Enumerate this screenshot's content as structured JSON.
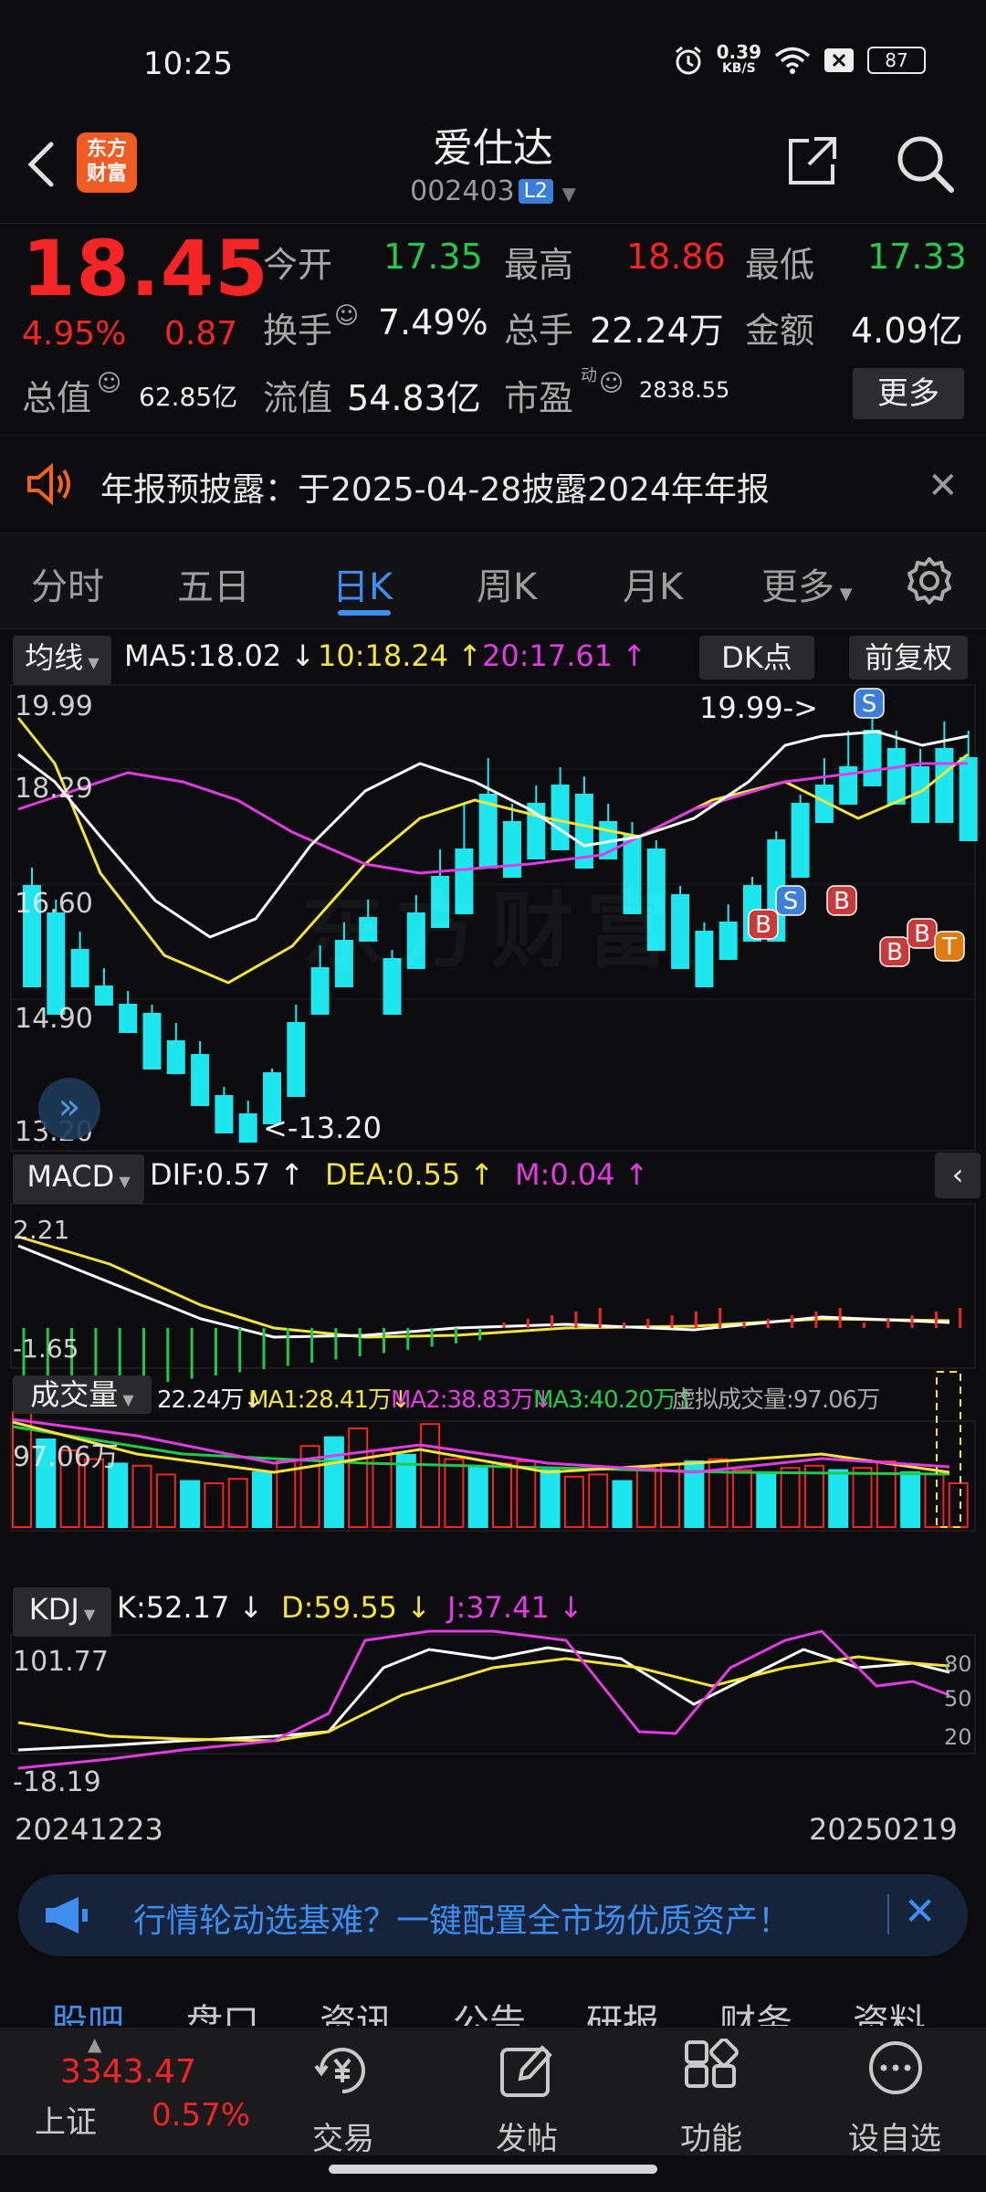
{
  "status_bar": {
    "time": "10:25",
    "net_speed_top": "0.39",
    "net_speed_bottom": "KB/S",
    "battery": "87"
  },
  "header": {
    "logo_line1": "东方",
    "logo_line2": "财富",
    "stock_name": "爱仕达",
    "stock_code": "002403",
    "level_badge": "L2"
  },
  "quote": {
    "price": "18.45",
    "change_pct": "4.95%",
    "change_amt": "0.87",
    "open_label": "今开",
    "open": "17.35",
    "high_label": "最高",
    "high": "18.86",
    "low_label": "最低",
    "low": "17.33",
    "turnover_label": "换手",
    "turnover": "7.49%",
    "volume_label": "总手",
    "volume": "22.24万",
    "amount_label": "金额",
    "amount": "4.09亿",
    "mktcap_label": "总值",
    "mktcap": "62.85亿",
    "float_label": "流值",
    "float": "54.83亿",
    "pe_label": "市盈",
    "pe_sup": "动",
    "pe": "2838.55",
    "more_button": "更多"
  },
  "notice": {
    "text": "年报预披露：于2025-04-28披露2024年年报"
  },
  "period_tabs": [
    {
      "label": "分时"
    },
    {
      "label": "五日"
    },
    {
      "label": "日K",
      "active": true
    },
    {
      "label": "周K"
    },
    {
      "label": "月K"
    },
    {
      "label": "更多"
    }
  ],
  "ma_row": {
    "selector": "均线",
    "ma5": "MA5:18.02 ↓",
    "ma10": "10:18.24 ↑",
    "ma20": "20:17.61 ↑",
    "dk_button": "DK点",
    "adjust_button": "前复权"
  },
  "kline": {
    "y_labels": [
      "19.99",
      "18.29",
      "16.60",
      "14.90",
      "13.20"
    ],
    "max_marker": "19.99->",
    "min_marker": "<-13.20",
    "watermark": "东方财富",
    "signals": [
      "S",
      "S",
      "B",
      "B",
      "B",
      "B",
      "T"
    ]
  },
  "macd": {
    "selector": "MACD",
    "dif": "DIF:0.57 ↑",
    "dea": "DEA:0.55 ↑",
    "m": "M:0.04 ↑",
    "y_top": "2.21",
    "y_bottom": "-1.65"
  },
  "volume_panel": {
    "selector": "成交量",
    "vol": "22.24万↓",
    "ma1": "MA1:28.41万↓",
    "ma2": "MA2:38.83万↓",
    "ma3": "MA3:40.20万↑",
    "virtual": "虚拟成交量:97.06万",
    "y_top": "97.06万"
  },
  "kdj": {
    "selector": "KDJ",
    "k": "K:52.17 ↓",
    "d": "D:59.55 ↓",
    "j": "J:37.41 ↓",
    "y_top": "101.77",
    "y_bottom": "-18.19",
    "levels": [
      "80",
      "50",
      "20"
    ]
  },
  "dates": {
    "start": "20241223",
    "end": "20250219"
  },
  "ad_banner": {
    "text": "行情轮动选基难？一键配置全市场优质资产！"
  },
  "bottom_tabs": [
    "股吧",
    "盘口",
    "资讯",
    "公告",
    "研报",
    "财务",
    "资料"
  ],
  "bottom_nav": {
    "index_value": "3343.47",
    "index_name": "上证",
    "index_pct": "0.57%",
    "items": [
      {
        "label": "交易"
      },
      {
        "label": "发帖"
      },
      {
        "label": "功能"
      },
      {
        "label": "设自选"
      }
    ]
  },
  "colors": {
    "up": "#f42525",
    "down": "#1ee6ee",
    "accent": "#3d8ef0",
    "ma5": "#ffffff",
    "ma10": "#f3e33a",
    "ma20": "#e23be3"
  }
}
